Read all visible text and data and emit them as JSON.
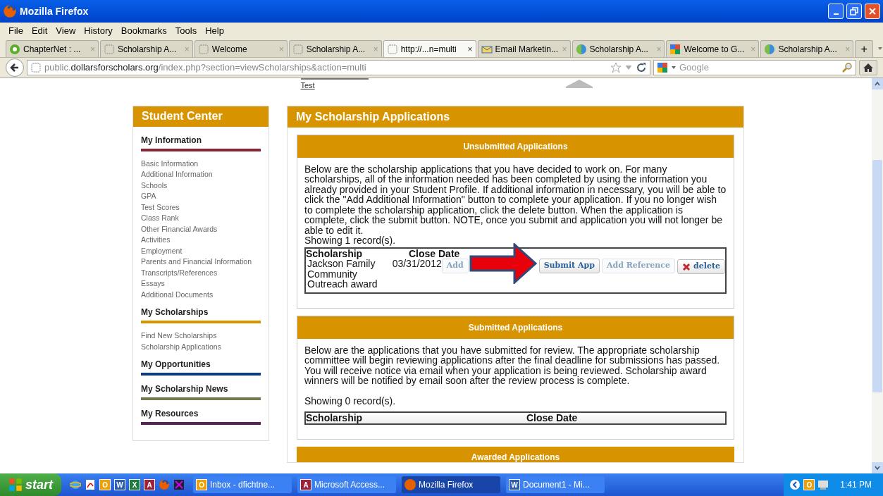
{
  "window": {
    "title": "Mozilla Firefox"
  },
  "menu": [
    "File",
    "Edit",
    "View",
    "History",
    "Bookmarks",
    "Tools",
    "Help"
  ],
  "tabs": [
    {
      "label": "ChapterNet : ...",
      "kind": "flower",
      "selected": false
    },
    {
      "label": "Scholarship A...",
      "kind": "blank",
      "selected": false
    },
    {
      "label": "Welcome",
      "kind": "blank",
      "selected": false
    },
    {
      "label": "Scholarship A...",
      "kind": "blank",
      "selected": false
    },
    {
      "label": "http://...n=multi",
      "kind": "blank",
      "selected": true
    },
    {
      "label": "Email Marketin...",
      "kind": "mail",
      "selected": false
    },
    {
      "label": "Scholarship A...",
      "kind": "globe",
      "selected": false
    },
    {
      "label": "Welcome to G...",
      "kind": "google",
      "selected": false
    },
    {
      "label": "Scholarship A...",
      "kind": "globe",
      "selected": false
    }
  ],
  "tab_close": "×",
  "new_tab": "+",
  "address": {
    "prefix": "public.",
    "domain": "dollarsforscholars.org",
    "path": "/index.php?section=viewScholarships&action=multi"
  },
  "search": {
    "placeholder": "Google"
  },
  "top_link": "Test",
  "sidebar": {
    "title": "Student Center",
    "groups": [
      {
        "heading": "My Information",
        "color": "#8b2332",
        "items": [
          "Basic Information",
          "Additional Information",
          "Schools",
          "GPA",
          "Test Scores",
          "Class Rank",
          "Other Financial Awards",
          "Activities",
          "Employment",
          "Parents and Financial Information",
          "Transcripts/References",
          "Essays",
          "Additional Documents"
        ]
      },
      {
        "heading": "My Scholarships",
        "color": "#d89400",
        "items": [
          "Find New Scholarships",
          "Scholarship Applications"
        ]
      },
      {
        "heading": "My Opportunities",
        "color": "#0a3a8c"
      },
      {
        "heading": "My Scholarship News",
        "color": "#6f7a52"
      },
      {
        "heading": "My Resources",
        "color": "#5a2157"
      }
    ]
  },
  "main": {
    "title": "My Scholarship Applications",
    "unsubmitted": {
      "title": "Unsubmitted Applications",
      "text": "Below are the scholarship applications that you have decided to work on. For many scholarships, all of the information needed has been completed by using the information you already provided in your Student Profile.  If additional information in necessary, you will be able to click the \"Add Additional Information\" button to complete your application. If you no longer wish to complete the scholarship application, click the delete button. When the application is complete, click the submit button. NOTE, once you submit and application you will not longer be able to edit it.",
      "count": "Showing 1 record(s).",
      "columns": [
        "Scholarship",
        "Close Date"
      ],
      "rows": [
        {
          "name": "Jackson Family Community Outreach award",
          "date": "03/31/2012",
          "buttons": [
            {
              "label": "Add",
              "disabled": true,
              "kind": "add-info"
            },
            {
              "label": "Submit App",
              "disabled": false,
              "kind": "plain"
            },
            {
              "label": "Add Reference",
              "disabled": true,
              "kind": "plain"
            },
            {
              "label": "delete",
              "disabled": false,
              "kind": "delete"
            }
          ]
        }
      ]
    },
    "submitted": {
      "title": "Submitted Applications",
      "text": "Below are the applications that you have submitted for review. The appropriate scholarship committee will begin reviewing applications after the final deadline for submissions has passed. You will receive notice via email when your application is being reviewed. Scholarship award winners will be notified by email soon after the review process is complete.",
      "count": "Showing 0 record(s).",
      "columns": [
        "Scholarship",
        "Close Date"
      ]
    },
    "awarded": {
      "title": "Awarded Applications"
    }
  },
  "taskbar": {
    "start": "start",
    "quick_launch": [
      {
        "kind": "ie"
      },
      {
        "kind": "pdf"
      },
      {
        "kind": "letter",
        "glyph": "O",
        "color": "#f0a000"
      },
      {
        "kind": "letter",
        "glyph": "W",
        "color": "#2a5cb8"
      },
      {
        "kind": "letter",
        "glyph": "X",
        "color": "#1e7b3c"
      },
      {
        "kind": "letter",
        "glyph": "A",
        "color": "#a0203c"
      },
      {
        "kind": "firefox"
      },
      {
        "kind": "media"
      }
    ],
    "windows": [
      {
        "label": "Inbox - dfichtne...",
        "glyph": "O",
        "color": "#f0a000",
        "selected": false
      },
      {
        "label": "Microsoft Access...",
        "glyph": "A",
        "color": "#a0203c",
        "selected": false
      },
      {
        "label": "Mozilla Firefox",
        "color": "#e66000",
        "selected": true
      },
      {
        "label": "Document1 - Mi...",
        "glyph": "W",
        "color": "#2a5cb8",
        "selected": false
      }
    ],
    "tray_glyph": "O",
    "clock": "1:41 PM"
  }
}
